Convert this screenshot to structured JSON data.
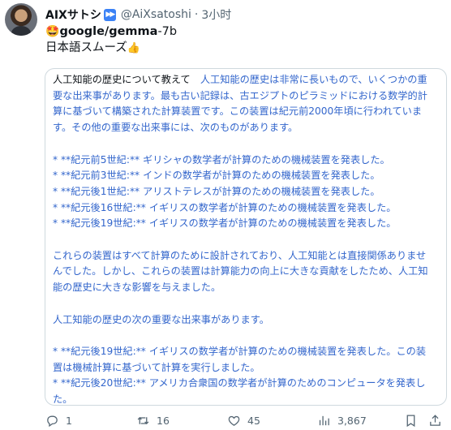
{
  "author": {
    "display_name": "AIXサトシ",
    "handle": "@AiXsatoshi",
    "separator": "·",
    "time": "3小时"
  },
  "post": {
    "model_emoji": "🤩",
    "model_name": "google/gemma",
    "model_suffix": "-7b",
    "comment": "日本語スムーズ",
    "comment_emoji": "👍"
  },
  "card": {
    "question": "人工知能の歴史について教えて",
    "para1": "人工知能の歴史は非常に長いもので、いくつかの重要な出来事があります。最も古い記録は、古エジプトのピラミッドにおける数学的計算に基づいて構築された計算装置です。この装置は紀元前2000年頃に行われています。その他の重要な出来事には、次のものがあります。",
    "list1": [
      "* **紀元前5世紀:** ギリシャの数学者が計算のための機械装置を発表した。",
      "* **紀元前3世紀:** インドの数学者が計算のための機械装置を発表した。",
      "* **紀元後1世紀:** アリストテレスが計算のための機械装置を発表した。",
      "* **紀元後16世紀:** イギリスの数学者が計算のための機械装置を発表した。",
      "* **紀元後19世紀:** イギリスの数学者が計算のための機械装置を発表した。"
    ],
    "para2": "これらの装置はすべて計算のために設計されており、人工知能とは直接関係ありませんでした。しかし、これらの装置は計算能力の向上に大きな貢献をしたため、人工知能の歴史に大きな影響を与えました。",
    "para3": "人工知能の歴史の次の重要な出来事があります。",
    "list2": [
      "* **紀元後19世紀:** イギリスの数学者が計算のための機械装置を発表した。この装置は機械計算に基づいて計算を実行しました。",
      "* **紀元後20世紀:** アメリカ合衆国の数学者が計算のためのコンピュータを発表した。"
    ]
  },
  "actions": {
    "reply_count": "1",
    "retweet_count": "16",
    "like_count": "45",
    "view_count": "3,867"
  },
  "icons": [
    "fast-forward-icon",
    "reply-icon",
    "retweet-icon",
    "like-icon",
    "views-icon",
    "bookmark-icon",
    "share-icon"
  ],
  "colors": {
    "link_blue": "#3366cc",
    "muted": "#536471",
    "border": "#cfd9de"
  }
}
